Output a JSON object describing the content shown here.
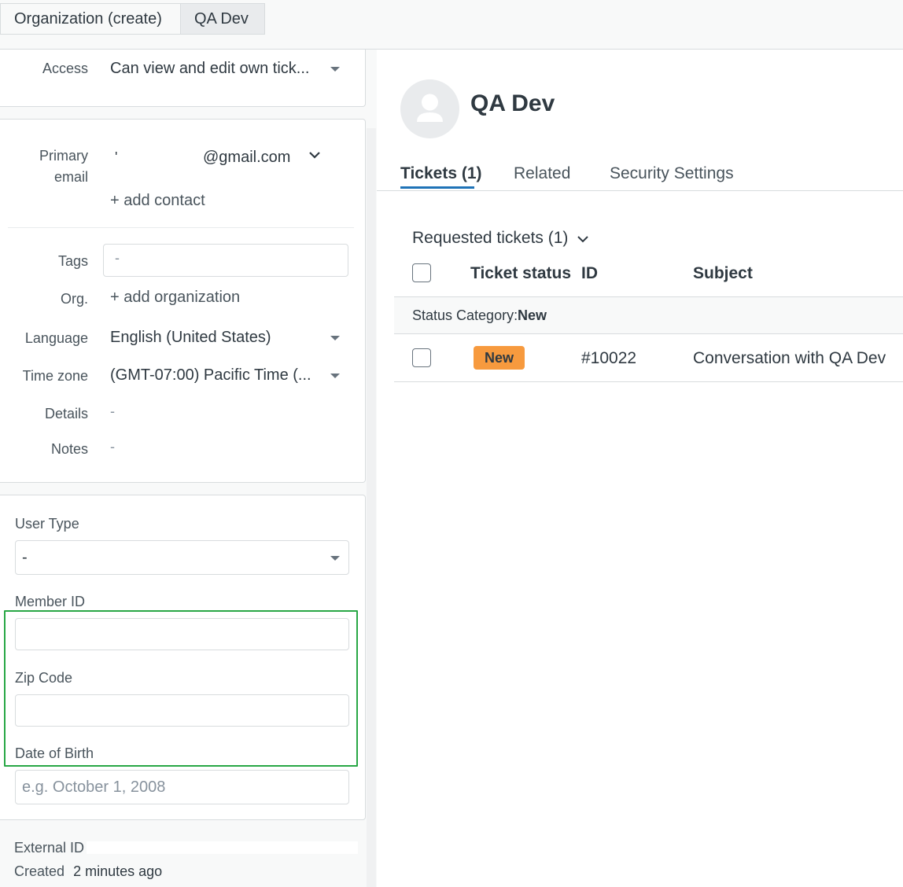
{
  "tabs": [
    {
      "label": "Organization (create)"
    },
    {
      "label": "QA Dev"
    }
  ],
  "left": {
    "access": {
      "label": "Access",
      "value": "Can view and edit own tick..."
    },
    "primary_email": {
      "label_line1": "Primary",
      "label_line2": "email",
      "prefix": "'",
      "value": "@gmail.com"
    },
    "add_contact": "+ add contact",
    "tags": {
      "label": "Tags",
      "value": "-"
    },
    "org": {
      "label": "Org.",
      "value": "+ add organization"
    },
    "language": {
      "label": "Language",
      "value": "English (United States)"
    },
    "timezone": {
      "label": "Time zone",
      "value": "(GMT-07:00) Pacific Time (..."
    },
    "details": {
      "label": "Details",
      "value": "-"
    },
    "notes": {
      "label": "Notes",
      "value": "-"
    },
    "user_type": {
      "label": "User Type",
      "value": "-"
    },
    "member_id": {
      "label": "Member ID",
      "value": ""
    },
    "zip_code": {
      "label": "Zip Code",
      "value": ""
    },
    "dob": {
      "label": "Date of Birth",
      "placeholder": "e.g. October 1, 2008"
    },
    "external_id": {
      "label": "External ID"
    },
    "created": {
      "label": "Created",
      "value": "2 minutes ago"
    }
  },
  "user": {
    "name": "QA Dev"
  },
  "right_tabs": [
    {
      "label": "Tickets (1)"
    },
    {
      "label": "Related"
    },
    {
      "label": "Security Settings"
    }
  ],
  "tickets": {
    "section_title": "Requested tickets (1)",
    "headers": {
      "status": "Ticket status",
      "id": "ID",
      "subject": "Subject"
    },
    "group": {
      "prefix": "Status Category:",
      "value": "New"
    },
    "rows": [
      {
        "status": "New",
        "id": "#10022",
        "subject": "Conversation with QA Dev"
      }
    ]
  },
  "colors": {
    "accent": "#1f73b7",
    "status_new": "#f79a3e",
    "highlight": "#28a745"
  }
}
